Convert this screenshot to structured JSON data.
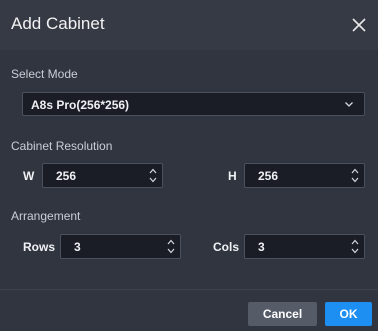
{
  "dialog": {
    "title": "Add Cabinet",
    "close_icon": "close-icon"
  },
  "select_mode": {
    "label": "Select Mode",
    "value": "A8s Pro(256*256)",
    "caret_icon": "chevron-down-icon"
  },
  "cabinet_resolution": {
    "label": "Cabinet Resolution",
    "w_label": "W",
    "w_value": "256",
    "h_label": "H",
    "h_value": "256"
  },
  "arrangement": {
    "label": "Arrangement",
    "rows_label": "Rows",
    "rows_value": "3",
    "cols_label": "Cols",
    "cols_value": "3"
  },
  "buttons": {
    "cancel": "Cancel",
    "ok": "OK"
  },
  "colors": {
    "background": "#31353f",
    "input_bg": "#1a1d26",
    "accent": "#1e8ff2",
    "cancel_bg": "#555b67"
  }
}
